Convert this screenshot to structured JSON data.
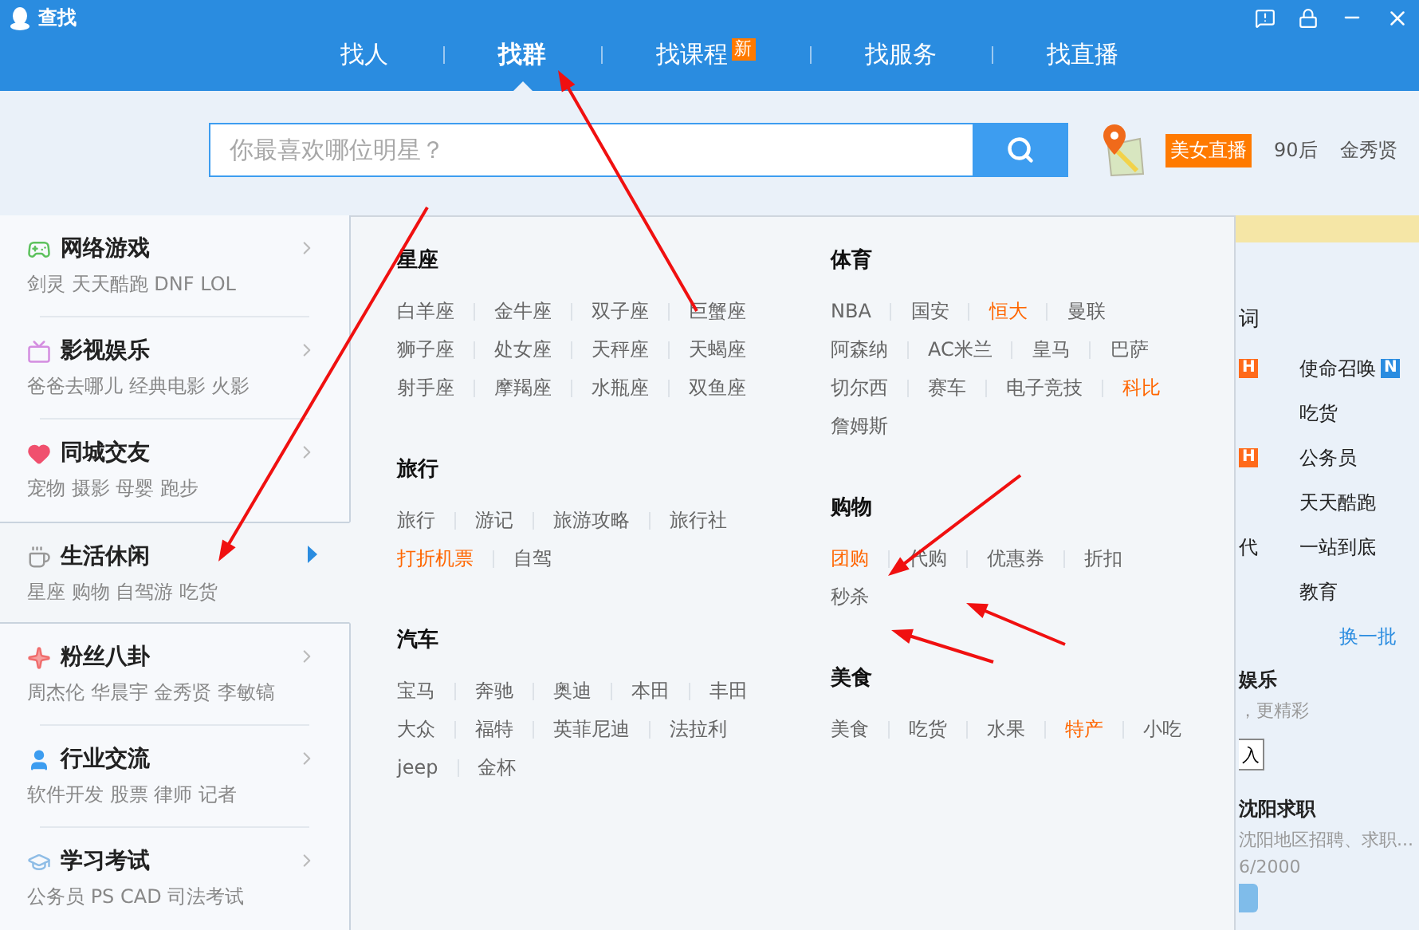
{
  "window": {
    "title": "查找"
  },
  "tabs": [
    {
      "label": "找人",
      "selected": false
    },
    {
      "label": "找群",
      "selected": true
    },
    {
      "label": "找课程",
      "selected": false,
      "badge": "新"
    },
    {
      "label": "找服务",
      "selected": false
    },
    {
      "label": "找直播",
      "selected": false
    }
  ],
  "search": {
    "placeholder": "你最喜欢哪位明星？"
  },
  "hot_tags": [
    {
      "label": "美女直播",
      "kind": "badge"
    },
    {
      "label": "90后",
      "kind": "plain"
    },
    {
      "label": "金秀贤",
      "kind": "plain"
    }
  ],
  "sidebar": {
    "items": [
      {
        "title": "网络游戏",
        "subtitle": "剑灵 天天酷跑 DNF LOL",
        "selected": false
      },
      {
        "title": "影视娱乐",
        "subtitle": "爸爸去哪儿 经典电影 火影",
        "selected": false
      },
      {
        "title": "同城交友",
        "subtitle": "宠物 摄影 母婴 跑步",
        "selected": false
      },
      {
        "title": "生活休闲",
        "subtitle": "星座 购物 自驾游 吃货",
        "selected": true
      },
      {
        "title": "粉丝八卦",
        "subtitle": "周杰伦 华晨宇 金秀贤 李敏镐",
        "selected": false
      },
      {
        "title": "行业交流",
        "subtitle": "软件开发 股票 律师 记者",
        "selected": false
      },
      {
        "title": "学习考试",
        "subtitle": "公务员 PS CAD 司法考试",
        "selected": false
      }
    ]
  },
  "panel": {
    "columns": [
      [
        {
          "heading": "星座",
          "rows": [
            [
              {
                "label": "白羊座",
                "hot": false
              },
              {
                "label": "金牛座",
                "hot": false
              },
              {
                "label": "双子座",
                "hot": false
              },
              {
                "label": "巨蟹座",
                "hot": false
              }
            ],
            [
              {
                "label": "狮子座",
                "hot": false
              },
              {
                "label": "处女座",
                "hot": false
              },
              {
                "label": "天秤座",
                "hot": false
              },
              {
                "label": "天蝎座",
                "hot": false
              }
            ],
            [
              {
                "label": "射手座",
                "hot": false
              },
              {
                "label": "摩羯座",
                "hot": false
              },
              {
                "label": "水瓶座",
                "hot": false
              },
              {
                "label": "双鱼座",
                "hot": false
              }
            ]
          ]
        },
        {
          "heading": "旅行",
          "rows": [
            [
              {
                "label": "旅行",
                "hot": false
              },
              {
                "label": "游记",
                "hot": false
              },
              {
                "label": "旅游攻略",
                "hot": false
              },
              {
                "label": "旅行社",
                "hot": false
              }
            ],
            [
              {
                "label": "打折机票",
                "hot": true
              },
              {
                "label": "自驾",
                "hot": false
              }
            ]
          ]
        },
        {
          "heading": "汽车",
          "rows": [
            [
              {
                "label": "宝马",
                "hot": false
              },
              {
                "label": "奔驰",
                "hot": false
              },
              {
                "label": "奥迪",
                "hot": false
              },
              {
                "label": "本田",
                "hot": false
              },
              {
                "label": "丰田",
                "hot": false
              }
            ],
            [
              {
                "label": "大众",
                "hot": false
              },
              {
                "label": "福特",
                "hot": false
              },
              {
                "label": "英菲尼迪",
                "hot": false
              },
              {
                "label": "法拉利",
                "hot": false
              }
            ],
            [
              {
                "label": "jeep",
                "hot": false
              },
              {
                "label": "金杯",
                "hot": false
              }
            ]
          ]
        }
      ],
      [
        {
          "heading": "体育",
          "rows": [
            [
              {
                "label": "NBA",
                "hot": false
              },
              {
                "label": "国安",
                "hot": false
              },
              {
                "label": "恒大",
                "hot": true
              },
              {
                "label": "曼联",
                "hot": false
              }
            ],
            [
              {
                "label": "阿森纳",
                "hot": false
              },
              {
                "label": "AC米兰",
                "hot": false
              },
              {
                "label": "皇马",
                "hot": false
              },
              {
                "label": "巴萨",
                "hot": false
              }
            ],
            [
              {
                "label": "切尔西",
                "hot": false
              },
              {
                "label": "赛车",
                "hot": false
              },
              {
                "label": "电子竞技",
                "hot": false
              },
              {
                "label": "科比",
                "hot": true
              }
            ],
            [
              {
                "label": "詹姆斯",
                "hot": false
              }
            ]
          ]
        },
        {
          "heading": "购物",
          "rows": [
            [
              {
                "label": "团购",
                "hot": true
              },
              {
                "label": "代购",
                "hot": false
              },
              {
                "label": "优惠券",
                "hot": false
              },
              {
                "label": "折扣",
                "hot": false
              }
            ],
            [
              {
                "label": "秒杀",
                "hot": false
              }
            ]
          ]
        },
        {
          "heading": "美食",
          "rows": [
            [
              {
                "label": "美食",
                "hot": false
              },
              {
                "label": "吃货",
                "hot": false
              },
              {
                "label": "水果",
                "hot": false
              },
              {
                "label": "特产",
                "hot": true
              },
              {
                "label": "小吃",
                "hot": false
              }
            ]
          ]
        }
      ]
    ]
  },
  "behind": {
    "heading": "词",
    "words": [
      {
        "left_badge": "H",
        "right": "使命召唤",
        "right_badge": "N"
      },
      {
        "right": "吃货"
      },
      {
        "left_badge": "H",
        "right": "公务员"
      },
      {
        "right": "天天酷跑"
      },
      {
        "left": "代",
        "right": "一站到底"
      },
      {
        "right": "教育"
      }
    ],
    "more_link": "换一批",
    "cards": [
      {
        "title": "娱乐",
        "desc": "，更精彩",
        "button": "入"
      },
      {
        "title": "沈阳求职",
        "desc": "沈阳地区招聘、求职...",
        "count": "6/2000"
      }
    ]
  }
}
